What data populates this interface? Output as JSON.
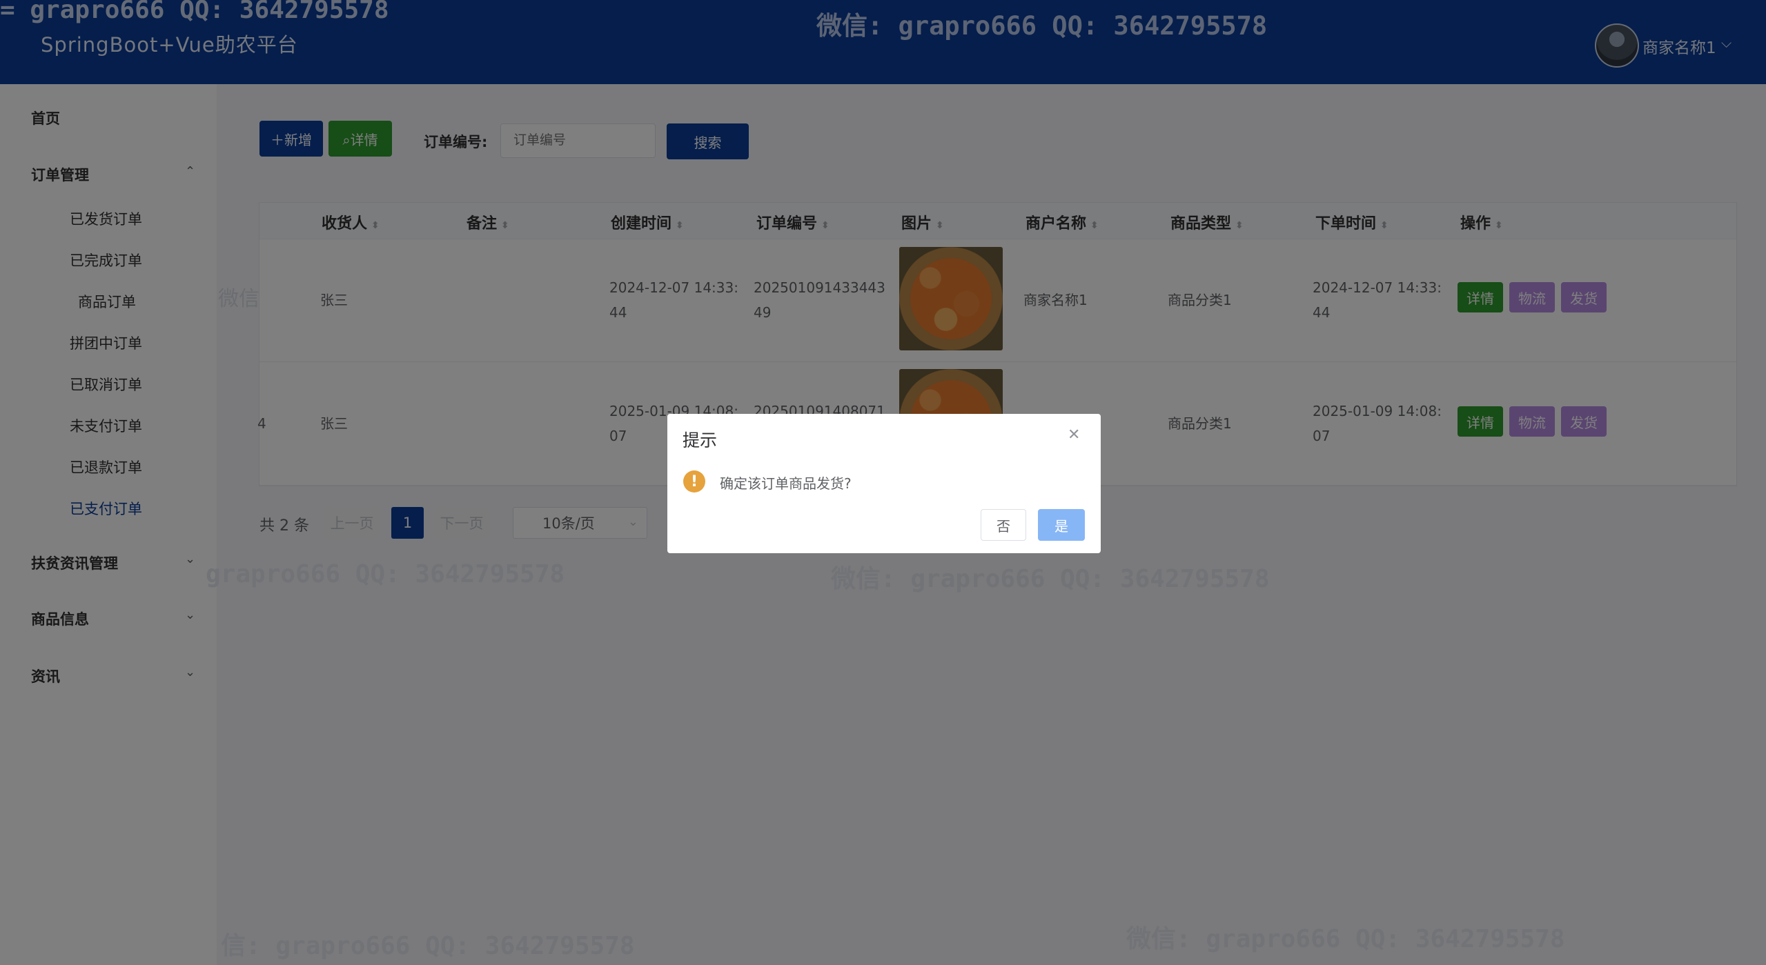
{
  "header": {
    "watermark_left": "= grapro666 QQ: 3642795578",
    "watermark_center": "微信: grapro666 QQ: 3642795578",
    "app_title": "SpringBoot+Vue助农平台",
    "user_name": "商家名称1",
    "user_caret": "⌵"
  },
  "sidebar": {
    "home": "首页",
    "order_mgmt": "订单管理",
    "order_items": [
      "已发货订单",
      "已完成订单",
      "商品订单",
      "拼团中订单",
      "已取消订单",
      "未支付订单",
      "已退款订单",
      "已支付订单"
    ],
    "active_item": "已支付订单",
    "poverty_news": "扶贫资讯管理",
    "product_info": "商品信息",
    "news": "资讯",
    "chev_up": "⌃",
    "chev_down": "⌄"
  },
  "toolbar": {
    "add_label": "＋新增",
    "detail_label": "⌕详情",
    "filter_label": "订单编号:",
    "filter_placeholder": "订单编号",
    "search_label": "搜索"
  },
  "table": {
    "columns": [
      "收货人",
      "备注",
      "创建时间",
      "订单编号",
      "图片",
      "商户名称",
      "商品类型",
      "下单时间",
      "操作"
    ],
    "sort_glyph": "⬍",
    "rows": [
      {
        "left_fragment": "微信",
        "receiver": "张三",
        "created_time_l1": "2024-12-07 14:33:",
        "created_time_l2": "44",
        "order_no_l1": "202501091433443",
        "order_no_l2": "49",
        "merchant": "商家名称1",
        "product_type": "商品分类1",
        "order_time_l1": "2024-12-07 14:33:",
        "order_time_l2": "44"
      },
      {
        "left_fragment": "4",
        "receiver": "张三",
        "created_time_l1": "2025-01-09 14:08:",
        "created_time_l2": "07",
        "order_no_l1": "202501091408071",
        "order_no_l2": "",
        "merchant": "",
        "product_type": "商品分类1",
        "order_time_l1": "2025-01-09 14:08:",
        "order_time_l2": "07"
      }
    ],
    "actions": {
      "detail": "详情",
      "logistics": "物流",
      "ship": "发货"
    }
  },
  "pagination": {
    "total": "共 2 条",
    "prev": "上一页",
    "current": "1",
    "next": "下一页",
    "page_size": "10条/页",
    "size_caret": "⌄"
  },
  "watermarks": [
    "grapro666 QQ: 3642795578",
    "微信: grapro666 QQ: 3642795578",
    "信: grapro666 QQ: 3642795578",
    "微信: grapro666 QQ: 3642795578"
  ],
  "dialog": {
    "title": "提示",
    "close": "✕",
    "icon": "!",
    "message": "确定该订单商品发货?",
    "no_label": "否",
    "yes_label": "是"
  },
  "colors": {
    "primary": "#0b3d99",
    "success": "#2e9a2e",
    "purple": "#b58be3",
    "warning": "#e6a23c",
    "confirm": "#87b6f6"
  }
}
